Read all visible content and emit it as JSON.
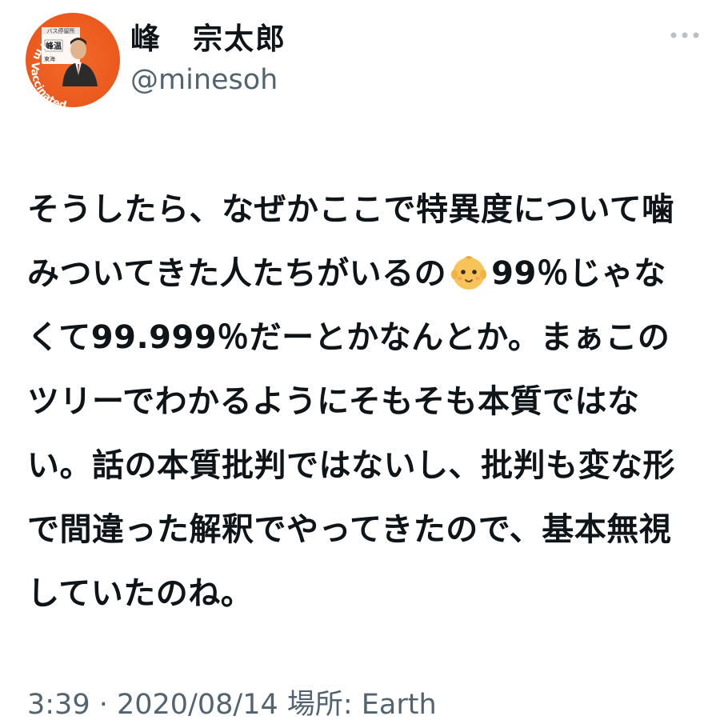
{
  "author": {
    "display_name": "峰　宗太郎",
    "handle": "@minesoh",
    "avatar": {
      "sign_top_text": "バス停留所",
      "sign_name_text": "峰温",
      "sign_side_text": "東海",
      "badge_text": "I'm Vaccinated",
      "colors": {
        "ring": "#ec5a1e",
        "sign": "#ffffff",
        "suit": "#2b2b2b"
      }
    }
  },
  "more_icon": "ellipsis-horizontal-icon",
  "tweet": {
    "lines": [
      {
        "segments": [
          {
            "text": "そうしたら、なぜかここで特異度について噛"
          }
        ]
      },
      {
        "segments": [
          {
            "text": "みついてきた人たちがいるの"
          },
          {
            "emoji": "baby-face-emoji"
          },
          {
            "text": "99％じゃな"
          }
        ]
      },
      {
        "segments": [
          {
            "text": "くて99.999％だーとかなんとか。まぁこの"
          }
        ]
      },
      {
        "segments": [
          {
            "text": "ツリーでわかるようにそもそも本質ではな"
          }
        ]
      },
      {
        "segments": [
          {
            "text": "い。話の本質批判ではないし、批判も変な形"
          }
        ]
      },
      {
        "segments": [
          {
            "text": "で間違った解釈でやってきたので、基本無視"
          }
        ]
      },
      {
        "segments": [
          {
            "text": "していたのね。"
          }
        ]
      }
    ]
  },
  "meta": {
    "time": "3:39",
    "separator": " · ",
    "date": "2020/08/14",
    "location_label": " 場所: ",
    "location": "Earth"
  },
  "colors": {
    "text": "#0f1419",
    "secondary": "#536471",
    "avatar_orange": "#ec5a1e",
    "emoji_skin": "#f7c45a"
  }
}
